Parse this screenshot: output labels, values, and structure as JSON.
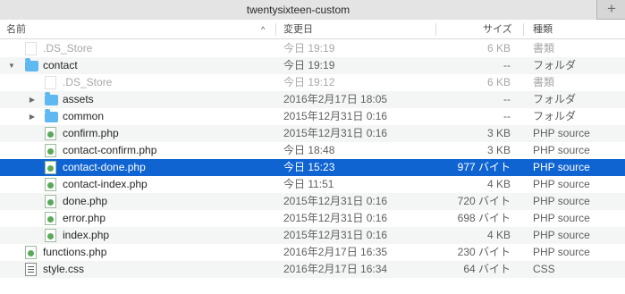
{
  "window": {
    "tab_title": "twentysixteen-custom",
    "add_tab": "+"
  },
  "columns": {
    "name": "名前",
    "date": "変更日",
    "size": "サイズ",
    "kind": "種類",
    "sort_indicator": "^"
  },
  "rows": [
    {
      "name": ".DS_Store",
      "date": "今日 19:19",
      "size": "6 KB",
      "kind": "書類",
      "icon": "document-icon",
      "depth": 1,
      "disclosure": "",
      "dim": true,
      "selected": false
    },
    {
      "name": "contact",
      "date": "今日 19:19",
      "size": "--",
      "kind": "フォルダ",
      "icon": "folder-icon",
      "depth": 1,
      "disclosure": "open",
      "dim": false,
      "selected": false
    },
    {
      "name": ".DS_Store",
      "date": "今日 19:12",
      "size": "6 KB",
      "kind": "書類",
      "icon": "document-icon",
      "depth": 2,
      "disclosure": "",
      "dim": true,
      "selected": false
    },
    {
      "name": "assets",
      "date": "2016年2月17日 18:05",
      "size": "--",
      "kind": "フォルダ",
      "icon": "folder-icon",
      "depth": 2,
      "disclosure": "closed",
      "dim": false,
      "selected": false
    },
    {
      "name": "common",
      "date": "2015年12月31日 0:16",
      "size": "--",
      "kind": "フォルダ",
      "icon": "folder-icon",
      "depth": 2,
      "disclosure": "closed",
      "dim": false,
      "selected": false
    },
    {
      "name": "confirm.php",
      "date": "2015年12月31日 0:16",
      "size": "3 KB",
      "kind": "PHP source",
      "icon": "php-file-icon",
      "depth": 2,
      "disclosure": "",
      "dim": false,
      "selected": false
    },
    {
      "name": "contact-confirm.php",
      "date": "今日 18:48",
      "size": "3 KB",
      "kind": "PHP source",
      "icon": "php-file-icon",
      "depth": 2,
      "disclosure": "",
      "dim": false,
      "selected": false
    },
    {
      "name": "contact-done.php",
      "date": "今日 15:23",
      "size": "977 バイト",
      "kind": "PHP source",
      "icon": "php-file-icon",
      "depth": 2,
      "disclosure": "",
      "dim": false,
      "selected": true
    },
    {
      "name": "contact-index.php",
      "date": "今日 11:51",
      "size": "4 KB",
      "kind": "PHP source",
      "icon": "php-file-icon",
      "depth": 2,
      "disclosure": "",
      "dim": false,
      "selected": false
    },
    {
      "name": "done.php",
      "date": "2015年12月31日 0:16",
      "size": "720 バイト",
      "kind": "PHP source",
      "icon": "php-file-icon",
      "depth": 2,
      "disclosure": "",
      "dim": false,
      "selected": false
    },
    {
      "name": "error.php",
      "date": "2015年12月31日 0:16",
      "size": "698 バイト",
      "kind": "PHP source",
      "icon": "php-file-icon",
      "depth": 2,
      "disclosure": "",
      "dim": false,
      "selected": false
    },
    {
      "name": "index.php",
      "date": "2015年12月31日 0:16",
      "size": "4 KB",
      "kind": "PHP source",
      "icon": "php-file-icon",
      "depth": 2,
      "disclosure": "",
      "dim": false,
      "selected": false
    },
    {
      "name": "functions.php",
      "date": "2016年2月17日 16:35",
      "size": "230 バイト",
      "kind": "PHP source",
      "icon": "php-file-icon",
      "depth": 1,
      "disclosure": "",
      "dim": false,
      "selected": false
    },
    {
      "name": "style.css",
      "date": "2016年2月17日 16:34",
      "size": "64 バイト",
      "kind": "CSS",
      "icon": "css-file-icon",
      "depth": 1,
      "disclosure": "",
      "dim": false,
      "selected": false
    }
  ],
  "colors": {
    "selection": "#0f64d2",
    "stripe": "#f4f5f5",
    "folder": "#5fb8f0"
  }
}
